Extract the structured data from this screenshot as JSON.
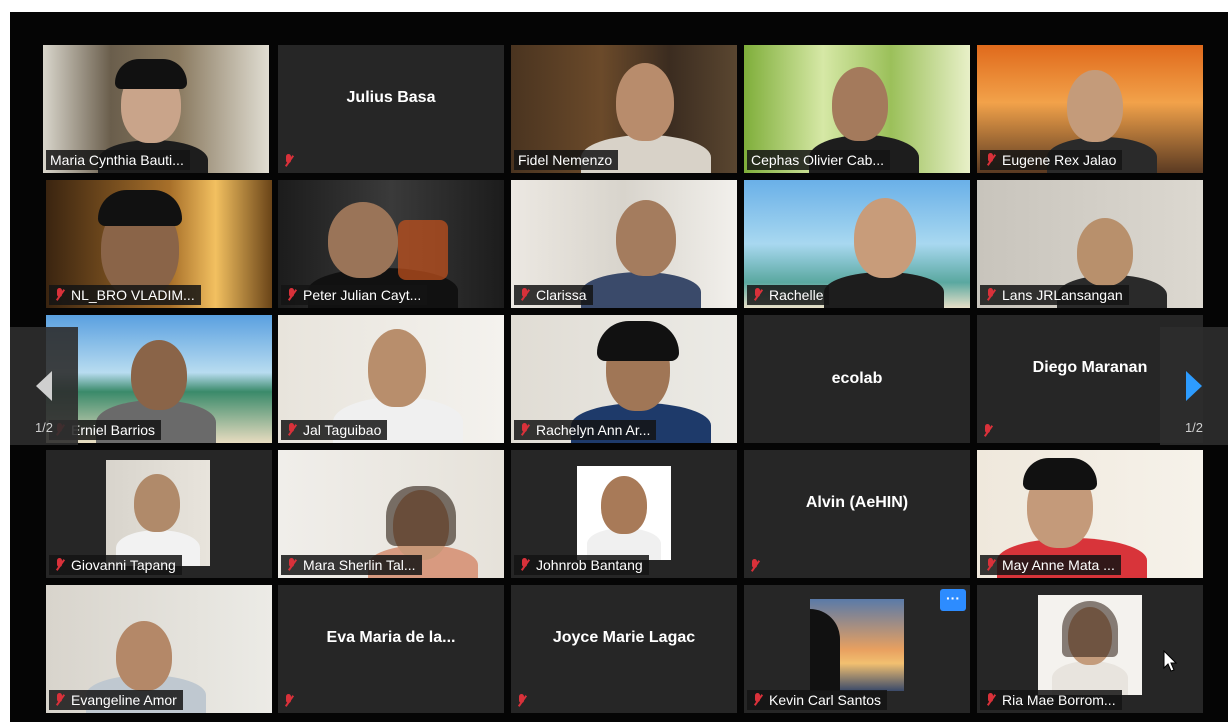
{
  "app": "Zoom gallery view",
  "pagination": {
    "current": "1/2"
  },
  "participants": [
    {
      "name": "Maria Cynthia Bauti...",
      "muted": false,
      "video": true,
      "active": true
    },
    {
      "name": "Julius Basa",
      "muted": true,
      "video": false
    },
    {
      "name": "Fidel Nemenzo",
      "muted": false,
      "video": true
    },
    {
      "name": "Cephas Olivier Cab...",
      "muted": false,
      "video": true
    },
    {
      "name": "Eugene Rex Jalao",
      "muted": true,
      "video": true
    },
    {
      "name": "NL_BRO VLADIM...",
      "muted": true,
      "video": true
    },
    {
      "name": "Peter Julian Cayt...",
      "muted": true,
      "video": true
    },
    {
      "name": "Clarissa",
      "muted": true,
      "video": true
    },
    {
      "name": "Rachelle",
      "muted": true,
      "video": true
    },
    {
      "name": "Lans JRLansangan",
      "muted": true,
      "video": true
    },
    {
      "name": "Erniel Barrios",
      "muted": true,
      "video": true
    },
    {
      "name": "Jal Taguibao",
      "muted": true,
      "video": true
    },
    {
      "name": "Rachelyn Ann Ar...",
      "muted": true,
      "video": true
    },
    {
      "name": "ecolab",
      "muted": false,
      "video": false
    },
    {
      "name": "Diego Maranan",
      "muted": true,
      "video": false
    },
    {
      "name": "Giovanni Tapang",
      "muted": true,
      "video": true
    },
    {
      "name": "Mara Sherlin Tal...",
      "muted": true,
      "video": true
    },
    {
      "name": "Johnrob Bantang",
      "muted": true,
      "video": true
    },
    {
      "name": "Alvin (AeHIN)",
      "muted": true,
      "video": false
    },
    {
      "name": "May Anne Mata ...",
      "muted": true,
      "video": true
    },
    {
      "name": "Evangeline Amor",
      "muted": true,
      "video": true
    },
    {
      "name": "Eva Maria de la...",
      "muted": true,
      "video": false
    },
    {
      "name": "Joyce Marie Lagac",
      "muted": true,
      "video": false
    },
    {
      "name": "Kevin Carl Santos",
      "muted": true,
      "video": true
    },
    {
      "name": "Ria Mae Borrom...",
      "muted": true,
      "video": true
    }
  ],
  "more_button": "···"
}
